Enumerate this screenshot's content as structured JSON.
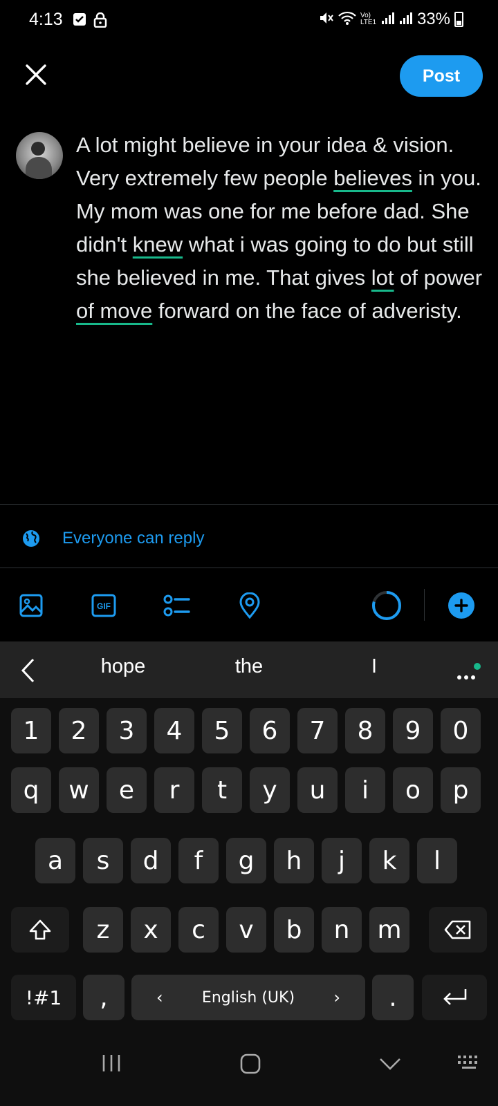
{
  "status_bar": {
    "time": "4:13",
    "network_label": "Vo) LTE1",
    "battery": "33%"
  },
  "compose": {
    "post_label": "Post",
    "text_segments": [
      {
        "text": "A lot might believe in your idea & vision. Very extremely few people ",
        "flagged": false
      },
      {
        "text": "believes",
        "flagged": true
      },
      {
        "text": " in you. My mom was one for me before dad. She didn't ",
        "flagged": false
      },
      {
        "text": "knew",
        "flagged": true
      },
      {
        "text": " what i was going to do but still she believed in me. That gives ",
        "flagged": false
      },
      {
        "text": "lot",
        "flagged": true
      },
      {
        "text": " of power ",
        "flagged": false
      },
      {
        "text": "of move",
        "flagged": true
      },
      {
        "text": " forward on the face of adveristy.",
        "flagged": false
      }
    ]
  },
  "reply_setting": {
    "label": "Everyone can reply"
  },
  "toolbar": {
    "gif_label": "GIF"
  },
  "keyboard": {
    "suggestions": [
      "hope",
      "the",
      "I"
    ],
    "number_row": [
      "1",
      "2",
      "3",
      "4",
      "5",
      "6",
      "7",
      "8",
      "9",
      "0"
    ],
    "row1": [
      "q",
      "w",
      "e",
      "r",
      "t",
      "y",
      "u",
      "i",
      "o",
      "p"
    ],
    "row2": [
      "a",
      "s",
      "d",
      "f",
      "g",
      "h",
      "j",
      "k",
      "l"
    ],
    "row3": [
      "z",
      "x",
      "c",
      "v",
      "b",
      "n",
      "m"
    ],
    "symbols_key": "!#1",
    "comma_key": ",",
    "period_key": ".",
    "space_label": "English (UK)"
  },
  "colors": {
    "accent": "#1d9bf0",
    "spellcheck_underline": "#18b88b",
    "background": "#000000",
    "key": "#2d2d2d"
  }
}
